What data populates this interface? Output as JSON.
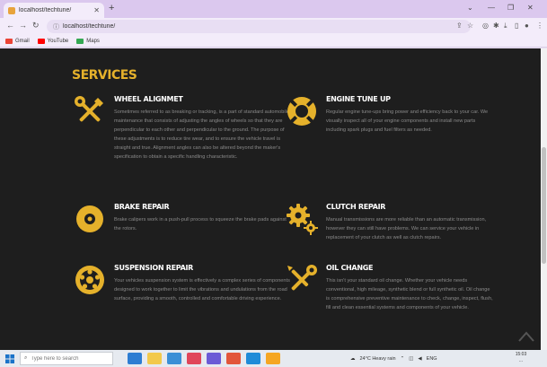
{
  "browser": {
    "tab_title": "localhost/techtune/",
    "url": "localhost/techtune/",
    "bookmarks": [
      {
        "label": "Gmail",
        "color": "#ea4335"
      },
      {
        "label": "YouTube",
        "color": "#ff0000"
      },
      {
        "label": "Maps",
        "color": "#34a853"
      }
    ]
  },
  "page": {
    "section_title": "SERVICES",
    "accent_color": "#e5b12b",
    "services": [
      {
        "title": "WHEEL ALIGNMET",
        "icon": "tools-icon",
        "description": "Sometimes referred to as breaking or tracking, is a part of standard automobile maintenance that consists of adjusting the angles of wheels so that they are perpendicular to each other and perpendicular to the ground. The purpose of these adjustments is to reduce tire wear, and to ensure the vehicle travel is straight and true. Alignment angles can also be altered beyond the maker's specification to obtain a specific handling characteristic."
      },
      {
        "title": "ENGINE TUNE UP",
        "icon": "lifebuoy-icon",
        "description": "Regular engine tune-ups bring power and efficiency back to your car. We visually inspect all of your engine components and install new parts including spark plugs and fuel filters as needed."
      },
      {
        "title": "BRAKE REPAIR",
        "icon": "brake-disc-icon",
        "description": "Brake calipers work in a push-pull process to squeeze the brake pads against the rotors."
      },
      {
        "title": "CLUTCH REPAIR",
        "icon": "gears-icon",
        "description": "Manual transmissions are more reliable than an automatic transmission, however they can still have problems. We can service your vehicle in replacement of your clutch as well as clutch repairs."
      },
      {
        "title": "SUSPENSION REPAIR",
        "icon": "wheel-icon",
        "description": "Your vehicles suspension system is effectively a complex series of components designed to work together to limit the vibrations and undulations from the road surface, providing a smooth, controlled and comfortable driving experience."
      },
      {
        "title": "OIL CHANGE",
        "icon": "wrench-screwdriver-icon",
        "description": "This isn't your standard oil change. Whether your vehicle needs conventional, high mileage, synthetic blend or full synthetic oil. Oil change is comprehensive preventive maintenance to check, change, inspect, flush, fill and clean essential systems and components of your vehicle."
      }
    ]
  },
  "taskbar": {
    "search_placeholder": "Type here to search",
    "weather": "24°C  Heavy rain",
    "language": "ENG",
    "time": "15:03",
    "date": "..."
  }
}
